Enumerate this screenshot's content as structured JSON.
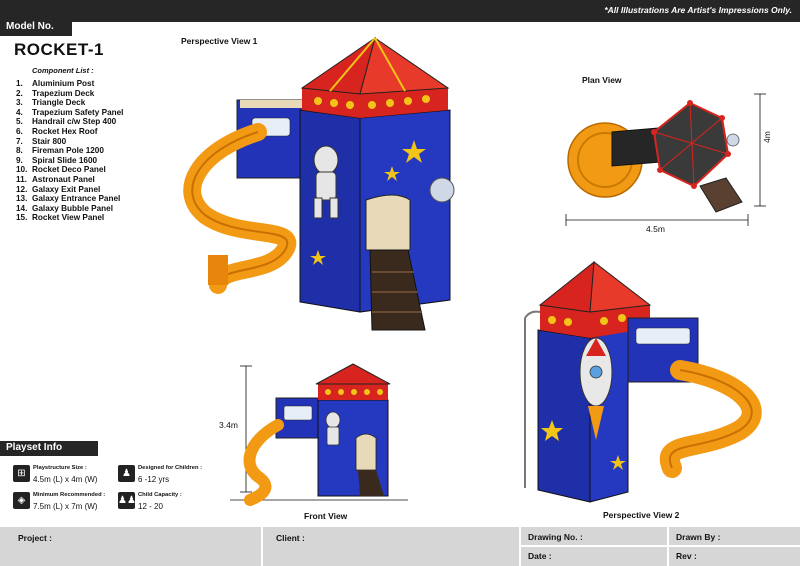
{
  "header": {
    "model_label": "Model No.",
    "disclaimer": "*All Illustrations Are Artist's Impressions Only."
  },
  "product": {
    "name": "ROCKET-1",
    "component_list_label": "Component List :",
    "components": [
      {
        "no": "1.",
        "name": "Aluminium Post"
      },
      {
        "no": "2.",
        "name": "Trapezium Deck"
      },
      {
        "no": "3.",
        "name": "Triangle Deck"
      },
      {
        "no": "4.",
        "name": "Trapezium Safety Panel"
      },
      {
        "no": "5.",
        "name": "Handrail c/w Step 400"
      },
      {
        "no": "6.",
        "name": "Rocket Hex Roof"
      },
      {
        "no": "7.",
        "name": "Stair 800"
      },
      {
        "no": "8.",
        "name": "Fireman Pole 1200"
      },
      {
        "no": "9.",
        "name": "Spiral  Slide 1600"
      },
      {
        "no": "10.",
        "name": "Rocket Deco Panel"
      },
      {
        "no": "11.",
        "name": "Astronaut Panel"
      },
      {
        "no": "12.",
        "name": "Galaxy Exit Panel"
      },
      {
        "no": "13.",
        "name": "Galaxy Entrance Panel"
      },
      {
        "no": "14.",
        "name": "Galaxy Bubble Panel"
      },
      {
        "no": "15.",
        "name": "Rocket View Panel"
      }
    ]
  },
  "views": {
    "perspective1": "Perspective View 1",
    "plan": "Plan View",
    "front": "Front View",
    "perspective2": "Perspective View 2"
  },
  "dimensions": {
    "plan_width": "4.5m",
    "plan_depth": "4m",
    "front_height": "3.4m"
  },
  "playset_info": {
    "heading": "Playset Info",
    "structure_size_label": "Playstructure Size :",
    "structure_size_value": "4.5m (L) x 4m (W)",
    "designed_for_label": "Designed for Children :",
    "designed_for_value": "6 -12 yrs",
    "minimum_label": "Minimum Recommended :",
    "minimum_value": "7.5m (L) x 7m (W)",
    "capacity_label": "Child Capacity :",
    "capacity_value": "12 - 20"
  },
  "footer": {
    "project": "Project :",
    "client": "Client :",
    "drawing_no": "Drawing No. :",
    "drawn_by": "Drawn By :",
    "date": "Date :",
    "rev": "Rev :"
  },
  "colors": {
    "dark_bar": "#262626",
    "panel_blue": "#2233b8",
    "roof_red": "#d8241e",
    "slide_orange": "#f29a14",
    "accent_yellow": "#f2c418",
    "footer_gray": "#d6d6d6"
  }
}
